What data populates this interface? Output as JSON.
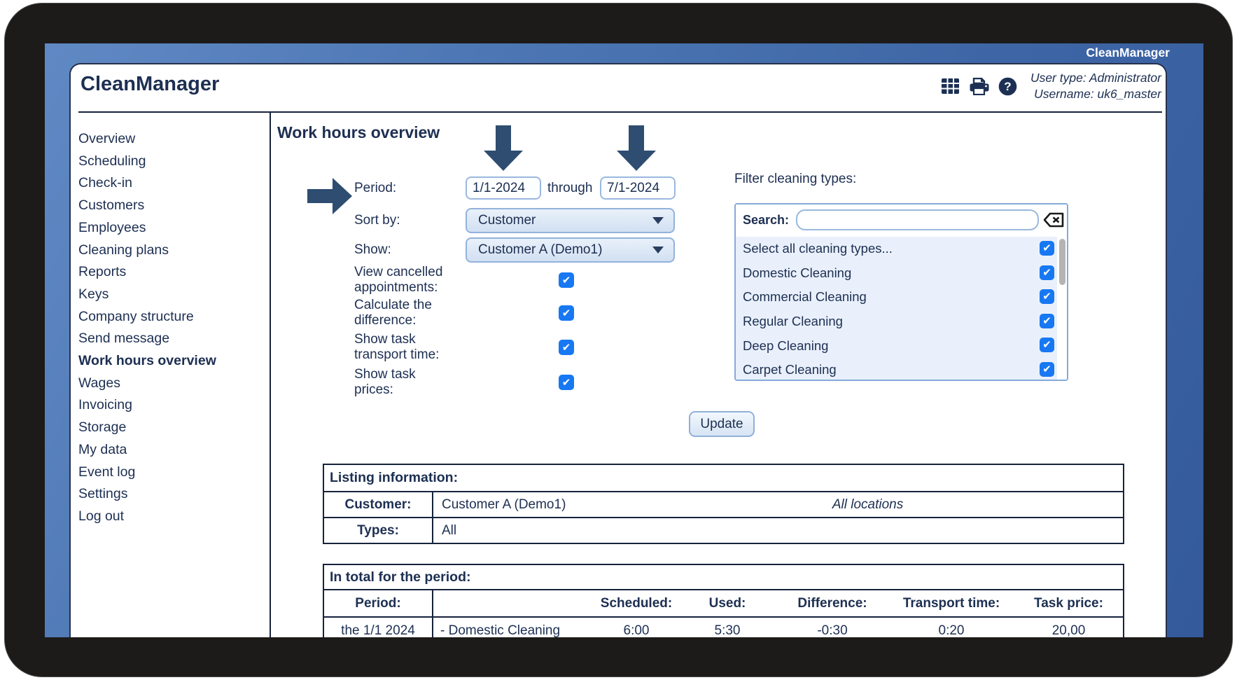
{
  "brand": {
    "window_badge": "CleanManager"
  },
  "header": {
    "title": "CleanManager",
    "user_type": "User type: Administrator",
    "username": "Username: uk6_master",
    "icons": [
      "table-icon",
      "print-icon",
      "help-icon"
    ]
  },
  "sidebar": {
    "items": [
      {
        "label": "Overview",
        "active": false
      },
      {
        "label": "Scheduling",
        "active": false
      },
      {
        "label": "Check-in",
        "active": false
      },
      {
        "label": "Customers",
        "active": false
      },
      {
        "label": "Employees",
        "active": false
      },
      {
        "label": "Cleaning plans",
        "active": false
      },
      {
        "label": "Reports",
        "active": false
      },
      {
        "label": "Keys",
        "active": false
      },
      {
        "label": "Company structure",
        "active": false
      },
      {
        "label": "Send message",
        "active": false
      },
      {
        "label": "Work hours overview",
        "active": true
      },
      {
        "label": "Wages",
        "active": false
      },
      {
        "label": "Invoicing",
        "active": false
      },
      {
        "label": "Storage",
        "active": false
      },
      {
        "label": "My data",
        "active": false
      },
      {
        "label": "Event log",
        "active": false
      },
      {
        "label": "Settings",
        "active": false
      },
      {
        "label": "Log out",
        "active": false
      }
    ]
  },
  "main": {
    "heading": "Work hours overview",
    "form": {
      "period": {
        "label": "Period:",
        "from": "1/1-2024",
        "through": "through",
        "to": "7/1-2024"
      },
      "sort_by": {
        "label": "Sort by:",
        "value": "Customer"
      },
      "show": {
        "label": "Show:",
        "value": "Customer A (Demo1)"
      },
      "toggles": [
        {
          "line1": "View cancelled",
          "line2": "appointments:",
          "checked": true
        },
        {
          "line1": "Calculate the",
          "line2": "difference:",
          "checked": true
        },
        {
          "line1": "Show task",
          "line2": "transport time:",
          "checked": true
        },
        {
          "line1": "Show task",
          "line2": "prices:",
          "checked": true
        }
      ]
    },
    "filter": {
      "title": "Filter cleaning types:",
      "search_label": "Search:",
      "search_value": "",
      "items": [
        {
          "label": "Select all cleaning types...",
          "checked": true
        },
        {
          "label": "Domestic Cleaning",
          "checked": true
        },
        {
          "label": "Commercial Cleaning",
          "checked": true
        },
        {
          "label": "Regular Cleaning",
          "checked": true
        },
        {
          "label": "Deep Cleaning",
          "checked": true
        },
        {
          "label": "Carpet Cleaning",
          "checked": true
        }
      ]
    },
    "update_button": "Update",
    "listing": {
      "title": "Listing information:",
      "rows": [
        {
          "label": "Customer:",
          "value": "Customer A (Demo1)",
          "note": "All locations"
        },
        {
          "label": "Types:",
          "value": "All",
          "note": ""
        }
      ]
    },
    "totals": {
      "title": "In total for the period:",
      "columns": [
        "Period:",
        "",
        "Scheduled:",
        "Used:",
        "Difference:",
        "Transport time:",
        "Task price:"
      ],
      "rows": [
        [
          "the 1/1 2024",
          "- Domestic Cleaning",
          "6:00",
          "5:30",
          "-0:30",
          "0:20",
          "20,00"
        ]
      ]
    }
  },
  "colors": {
    "text_navy": "#1d2f52",
    "border_navy": "#16233c",
    "panel_blue": "#4d77b4",
    "checkbox_blue": "#1778f2",
    "control_border": "#93b2dc",
    "list_bg": "#e9f0fb"
  }
}
